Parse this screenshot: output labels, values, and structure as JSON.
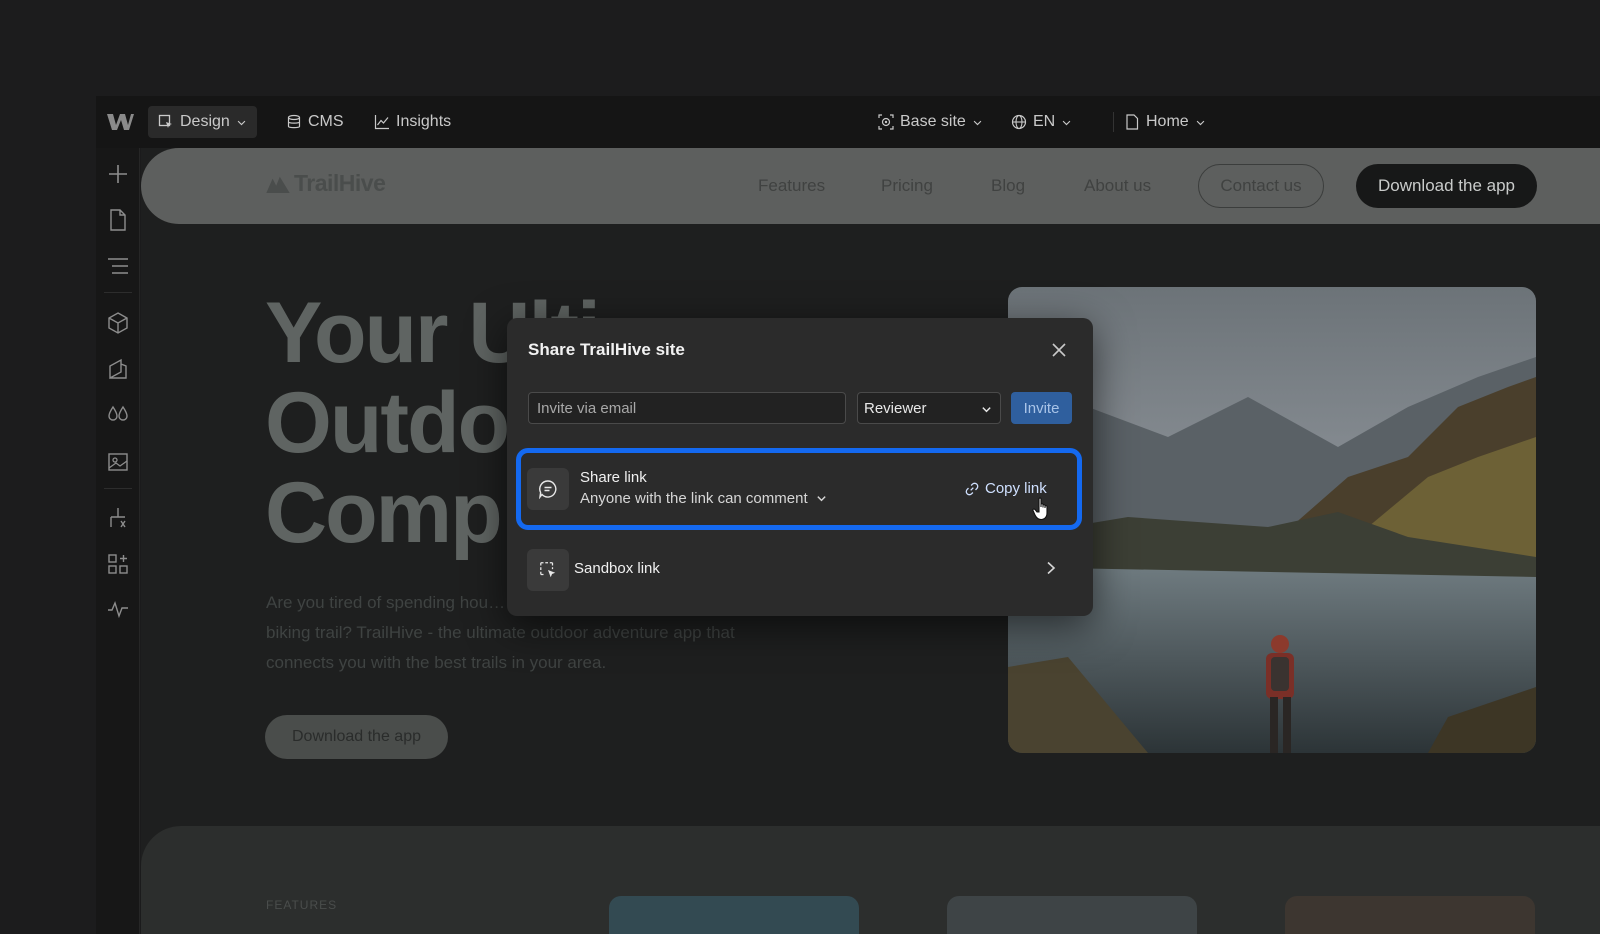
{
  "toolbar": {
    "design_label": "Design",
    "cms_label": "CMS",
    "insights_label": "Insights",
    "base_site_label": "Base site",
    "language_label": "EN",
    "page_label": "Home"
  },
  "site_preview": {
    "brand_name": "TrailHive",
    "nav_links": [
      "Features",
      "Pricing",
      "Blog",
      "About us"
    ],
    "contact_label": "Contact us",
    "download_label": "Download the app",
    "hero_title_lines": [
      "Your Ulti",
      "Outdo",
      "Comp"
    ],
    "hero_body": "Are you tired of spending hou… searching for the perfect hiking or biking trail? TrailHive - the ultimate outdoor adventure app that connects you with the best trails in your area.",
    "hero_button_label": "Download the app",
    "features_label": "FEATURES"
  },
  "share_modal": {
    "title": "Share TrailHive site",
    "email_placeholder": "Invite via email",
    "role_selected": "Reviewer",
    "invite_label": "Invite",
    "share_link_title": "Share link",
    "share_link_permission": "Anyone with the link can comment",
    "copy_link_label": "Copy link",
    "sandbox_link_label": "Sandbox link"
  },
  "colors": {
    "highlight_border": "#1469f0",
    "invite_button": "#2f5f9e",
    "modal_bg": "#2b2b2b",
    "app_bg": "#1c1c1d"
  },
  "icons": {
    "app_logo": "webflow-logo-icon",
    "design": "cursor-select-icon",
    "cms": "database-icon",
    "insights": "chart-line-icon",
    "base_site": "target-icon",
    "language": "globe-icon",
    "page": "page-icon",
    "close": "close-icon",
    "share_link": "comment-icon",
    "copy_link": "link-icon",
    "sandbox": "sandbox-icon",
    "chevron": "chevron-right-icon"
  }
}
